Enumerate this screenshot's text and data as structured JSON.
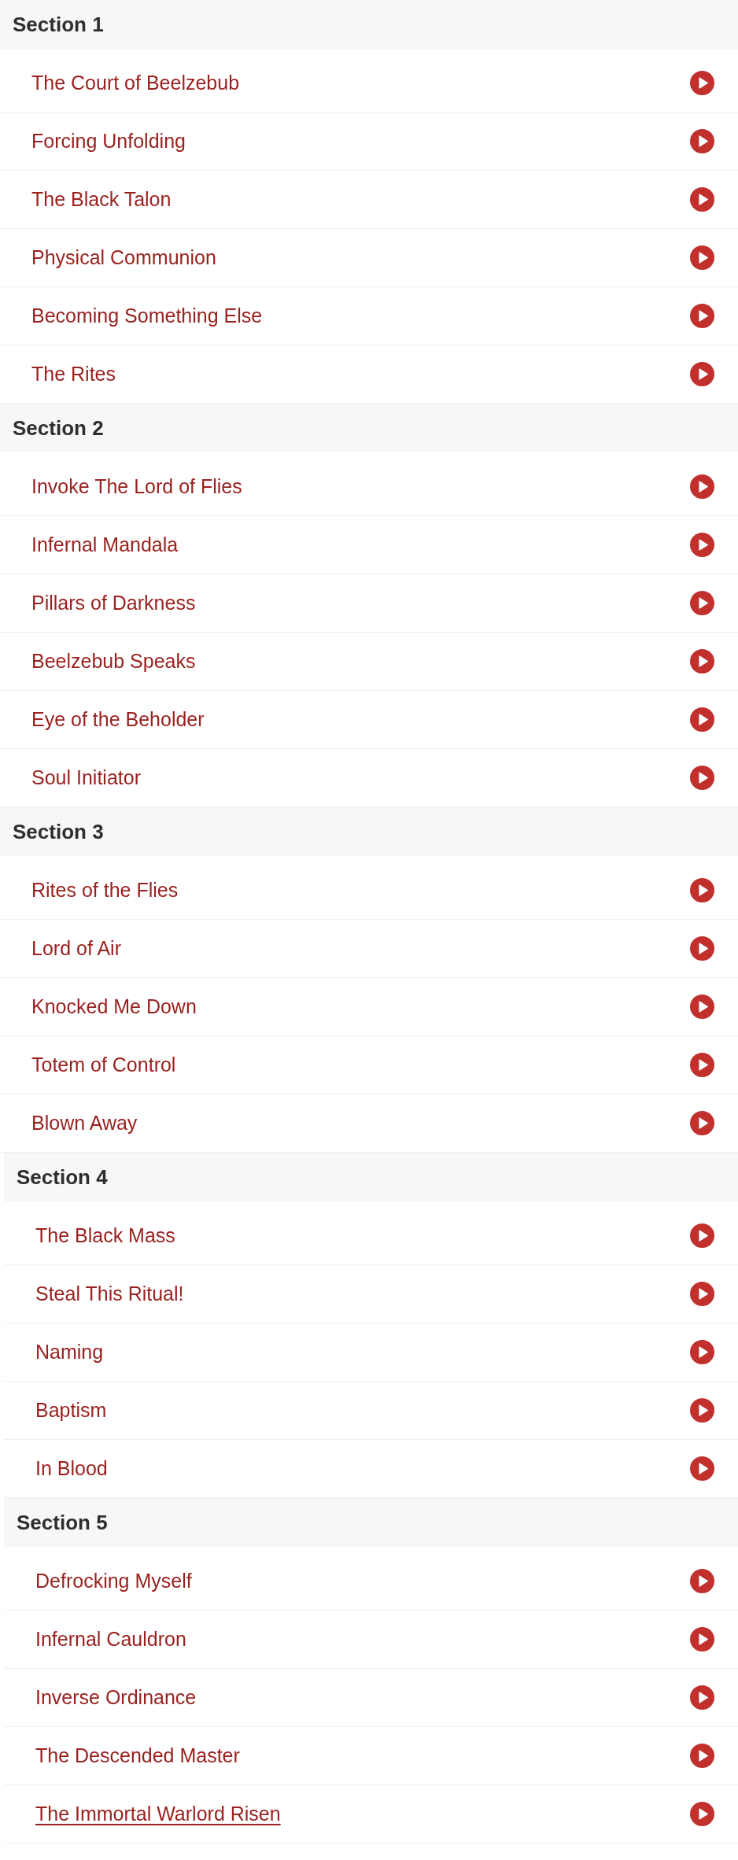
{
  "track_lists": [
    {
      "sections": [
        {
          "title": "Section 1",
          "tracks": [
            {
              "title": "The Court of Beelzebub",
              "hovered": false
            },
            {
              "title": "Forcing Unfolding",
              "hovered": false
            },
            {
              "title": "The Black Talon",
              "hovered": false
            },
            {
              "title": "Physical Communion",
              "hovered": false
            },
            {
              "title": "Becoming Something Else",
              "hovered": false
            },
            {
              "title": "The Rites",
              "hovered": false
            }
          ]
        },
        {
          "title": "Section 2",
          "tracks": [
            {
              "title": "Invoke The Lord of Flies",
              "hovered": false
            },
            {
              "title": "Infernal Mandala",
              "hovered": false
            },
            {
              "title": "Pillars of Darkness",
              "hovered": false
            },
            {
              "title": "Beelzebub Speaks",
              "hovered": false
            },
            {
              "title": "Eye of the Beholder",
              "hovered": false
            },
            {
              "title": "Soul Initiator",
              "hovered": false
            }
          ]
        },
        {
          "title": "Section 3",
          "tracks": [
            {
              "title": "Rites of the Flies",
              "hovered": false
            },
            {
              "title": "Lord of Air",
              "hovered": false
            },
            {
              "title": "Knocked Me Down",
              "hovered": false
            },
            {
              "title": "Totem of Control",
              "hovered": false
            },
            {
              "title": "Blown Away",
              "hovered": false
            }
          ]
        }
      ]
    },
    {
      "sections": [
        {
          "title": "Section 4",
          "tracks": [
            {
              "title": "The Black Mass",
              "hovered": false
            },
            {
              "title": "Steal This Ritual!",
              "hovered": false
            },
            {
              "title": "Naming",
              "hovered": false
            },
            {
              "title": "Baptism",
              "hovered": false
            },
            {
              "title": "In Blood",
              "hovered": false
            }
          ]
        },
        {
          "title": "Section 5",
          "tracks": [
            {
              "title": "Defrocking Myself",
              "hovered": false
            },
            {
              "title": "Infernal Cauldron",
              "hovered": false
            },
            {
              "title": "Inverse Ordinance",
              "hovered": false
            },
            {
              "title": "The Descended Master",
              "hovered": false
            },
            {
              "title": "The Immortal Warlord Risen",
              "hovered": true
            }
          ]
        }
      ]
    }
  ]
}
